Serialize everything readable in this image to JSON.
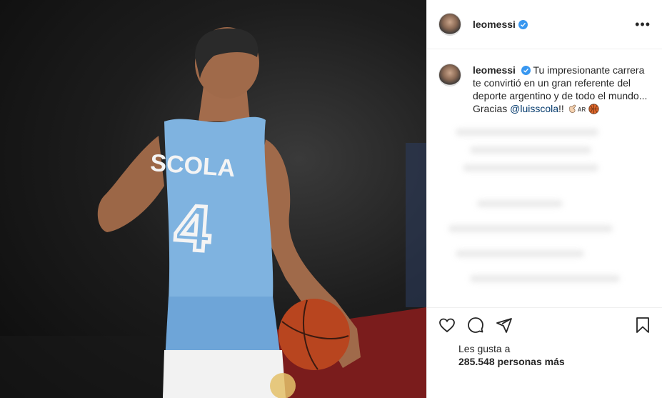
{
  "header": {
    "username": "leomessi",
    "verified": true,
    "more_icon": "•••"
  },
  "caption": {
    "username": "leomessi",
    "text": "Tu impresionante carrera te convirtió en un gran referente del deporte argentino y de todo el mundo... Gracias ",
    "mention": "@luisscola",
    "suffix": "!!",
    "flag_label": "AR",
    "emojis": [
      "clapping-hands",
      "argentina-flag",
      "basketball"
    ]
  },
  "photo": {
    "jersey_name": "SCOLA",
    "jersey_number": "4",
    "colors": {
      "jersey": "#7fb3e0",
      "shorts_white": "#f2f2f2",
      "ball": "#b8451f",
      "floor": "#8c1f1f"
    }
  },
  "likes": {
    "line1": "Les gusta a",
    "count": "285.548",
    "suffix": " personas más"
  },
  "accent": "#0095f6"
}
